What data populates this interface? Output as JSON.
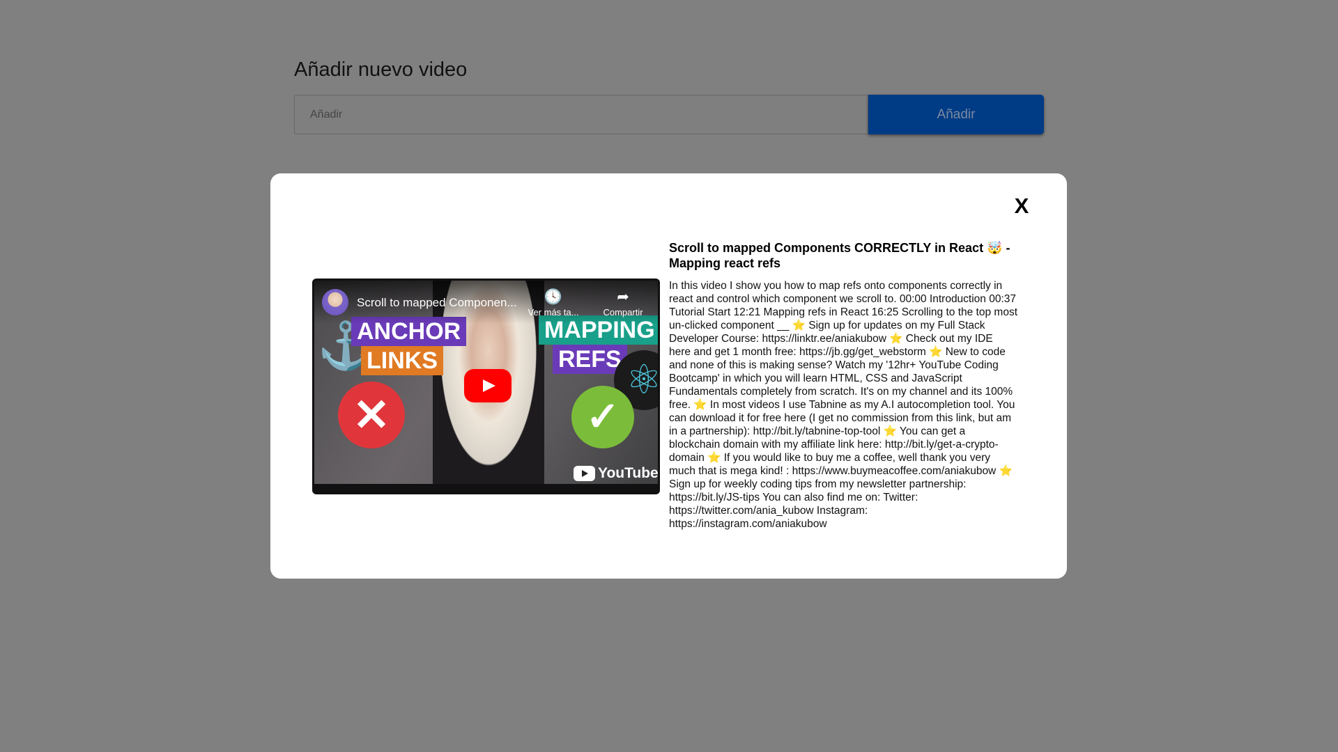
{
  "add_video": {
    "title": "Añadir nuevo video",
    "input_placeholder": "Añadir",
    "button_label": "Añadir"
  },
  "modal": {
    "close_label": "X",
    "player": {
      "title": "Scroll to mapped Componen...",
      "watch_later_label": "Ver más ta...",
      "share_label": "Compartir",
      "logo_text": "YouTube",
      "thumbnail_text": {
        "anchor_top": "ANCHOR",
        "anchor_bottom": "LINKS",
        "mapping_top": "MAPPING",
        "mapping_bottom": "REFS"
      }
    },
    "video_title": "Scroll to mapped Components CORRECTLY in React 🤯 - Mapping react refs",
    "video_description": "In this video I show you how to map refs onto components correctly in react and control which component we scroll to. 00:00 Introduction 00:37 Tutorial Start 12:21 Mapping refs in React 16:25 Scrolling to the top most un-clicked component __ ⭐ Sign up for updates on my Full Stack Developer Course: https://linktr.ee/aniakubow ⭐ Check out my IDE here and get 1 month free: https://jb.gg/get_webstorm ⭐ New to code and none of this is making sense? Watch my '12hr+ YouTube Coding Bootcamp' in which you will learn HTML, CSS and JavaScript Fundamentals completely from scratch. It's on my channel and its 100% free. ⭐ In most videos I use Tabnine as my A.I autocompletion tool. You can download it for free here (I get no commission from this link, but am in a partnership): http://bit.ly/tabnine-top-tool ⭐ You can get a blockchain domain with my affiliate link here: http://bit.ly/get-a-crypto-domain ⭐ If you would like to buy me a coffee, well thank you very much that is mega kind! : https://www.buymeacoffee.com/aniakubow ⭐ Sign up for weekly coding tips from my newsletter partnership: https://bit.ly/JS-tips You can also find me on: Twitter: https://twitter.com/ania_kubow Instagram: https://instagram.com/aniakubow"
  },
  "colors": {
    "backdrop": "#808080",
    "primary_button": "#003b85",
    "modal_background": "#ffffff",
    "play_button": "#ff0000"
  },
  "icons": {
    "watch_later": "clock-icon",
    "share": "share-icon",
    "play": "play-icon",
    "close": "close-icon"
  }
}
